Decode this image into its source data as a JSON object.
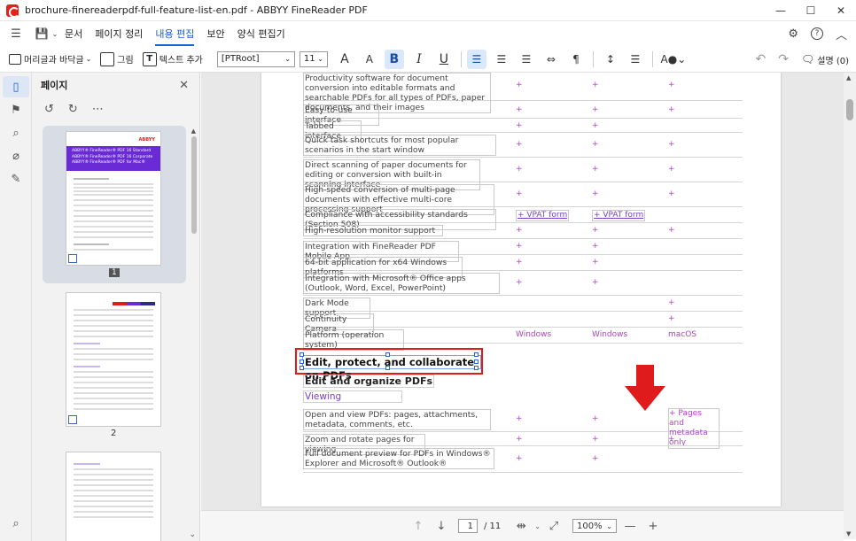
{
  "window": {
    "title": "brochure-finereaderpdf-full-feature-list-en.pdf - ABBYY FineReader PDF",
    "minimize": "—",
    "maximize": "☐",
    "close": "✕"
  },
  "menu": {
    "hamburger": "☰",
    "save": "💾",
    "items": [
      "문서",
      "페이지 정리",
      "내용 편집",
      "보안",
      "양식 편집기"
    ],
    "active_index": 2,
    "right_icons": {
      "settings": "⚙",
      "help": "?",
      "collapse": "︿"
    }
  },
  "toolbar": {
    "header_footer": "머리글과 바닥글",
    "picture": "그림",
    "add_text": "텍스트 추가",
    "font": "[PTRoot]",
    "size": "11",
    "font_grow": "A",
    "font_shrink": "A",
    "bold": "B",
    "italic": "I",
    "underline": "U",
    "comments": "설명 (0)",
    "undo": "↶",
    "redo": "↷"
  },
  "panel": {
    "title": "페이지",
    "page_numbers": [
      "1",
      "2"
    ],
    "thumb1_title_lines": [
      "ABBYY® FineReader® PDF 16 Standard",
      "ABBYY® FineReader® PDF 16 Corporate",
      "ABBYY® FineReader® PDF for Mac®"
    ],
    "thumb1_logo": "ABBYY"
  },
  "document": {
    "rows": [
      {
        "text": "Productivity software for document conversion into editable formats and searchable PDFs for all types of PDFs, paper documents, and their images",
        "c2": "+",
        "c3": "+",
        "c4": "+"
      },
      {
        "text": "Easy-to-use interface",
        "c2": "+",
        "c3": "+",
        "c4": "+"
      },
      {
        "text": "Tabbed interface",
        "c2": "+",
        "c3": "+",
        "c4": ""
      },
      {
        "text": "Quick task shortcuts for most popular scenarios in the start window",
        "c2": "+",
        "c3": "+",
        "c4": "+"
      },
      {
        "text": "Direct scanning of paper documents for editing or conversion with built-in scanning interface",
        "c2": "+",
        "c3": "+",
        "c4": "+"
      },
      {
        "text": "High-speed conversion of multi-page documents with effective multi-core processing support",
        "c2": "+",
        "c3": "+",
        "c4": "+"
      },
      {
        "text": "Compliance with accessibility standards (Section 508)",
        "c2": "+ VPAT form",
        "c3": "+ VPAT form",
        "c4": ""
      },
      {
        "text": "High-resolution monitor support",
        "c2": "+",
        "c3": "+",
        "c4": "+"
      },
      {
        "text": "Integration with FineReader PDF Mobile App",
        "c2": "+",
        "c3": "+",
        "c4": ""
      },
      {
        "text": "64-bit application for x64 Windows platforms",
        "c2": "+",
        "c3": "+",
        "c4": ""
      },
      {
        "text": "Integration with Microsoft® Office apps (Outlook, Word, Excel, PowerPoint)",
        "c2": "+",
        "c3": "+",
        "c4": ""
      },
      {
        "text": "Dark Mode support",
        "c2": "",
        "c3": "",
        "c4": "+"
      },
      {
        "text": "Continuity Camera",
        "c2": "",
        "c3": "",
        "c4": "+"
      },
      {
        "text": "Platform (operation system)",
        "c2": "Windows",
        "c3": "Windows",
        "c4": "macOS"
      }
    ],
    "section_title": "Edit, protect, and collaborate on PDFs",
    "subsection_title": "Edit and organize PDFs",
    "subsubsection_title": "Viewing",
    "rows2": [
      {
        "text": "Open and view PDFs: pages, attachments, metadata, comments, etc.",
        "c2": "+",
        "c3": "+",
        "c4": "+ Pages and metadata only"
      },
      {
        "text": "Zoom and rotate pages for viewing",
        "c2": "+",
        "c3": "+",
        "c4": "+"
      },
      {
        "text": "Full document preview for PDFs in Windows® Explorer and Microsoft® Outlook®",
        "c2": "+",
        "c3": "+",
        "c4": ""
      }
    ]
  },
  "bottom": {
    "page_input": "1",
    "page_total": "/ 11",
    "zoom": "100%",
    "minus": "—",
    "plus": "+"
  },
  "colors": {
    "accent": "#1a5fd6",
    "highlight_red": "#e01b1b",
    "table_plus": "#b042c8",
    "thumb_banner": "#6a2bd6"
  }
}
